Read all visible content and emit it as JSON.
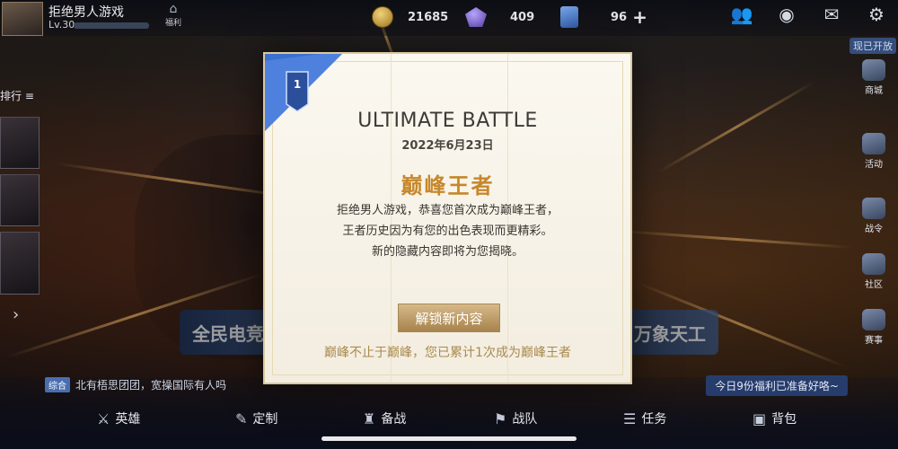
{
  "player": {
    "name": "拒绝男人游戏",
    "level": "Lv.30",
    "exp_fraction": 0.0
  },
  "welfare_label": "福利",
  "currencies": {
    "gold": "21685",
    "diamonds": "409",
    "vouchers": "96"
  },
  "sidebar": {
    "rank_label": "排行 ≡"
  },
  "right_sidebar": {
    "news": "现已开放",
    "items": [
      "商城",
      "活动",
      "战令",
      "社区",
      "赛事"
    ]
  },
  "banners": {
    "left": "全民电竞",
    "right": "万象天工"
  },
  "announcement": {
    "tag": "综合",
    "text": "北有梧思团团，宽操国际有人吗"
  },
  "welfare_strip": "今日9份福利已准备好咯~",
  "bottom_nav": [
    "英雄",
    "定制",
    "备战",
    "战队",
    "任务",
    "背包"
  ],
  "modal": {
    "badge_number": "1",
    "title": "ULTIMATE BATTLE",
    "date": "2022年6月23日",
    "rank_name": "巅峰王者",
    "message_lines": [
      "拒绝男人游戏，恭喜您首次成为巅峰王者，",
      "王者历史因为有您的出色表现而更精彩。",
      "新的隐藏内容即将为您揭晓。"
    ],
    "button_label": "解锁新内容",
    "footer": "巅峰不止于巅峰，您已累计1次成为巅峰王者"
  },
  "colors": {
    "accent_gold": "#c7872a",
    "ribbon_blue": "#3b6fd0",
    "button_tan": "#b8955e"
  }
}
